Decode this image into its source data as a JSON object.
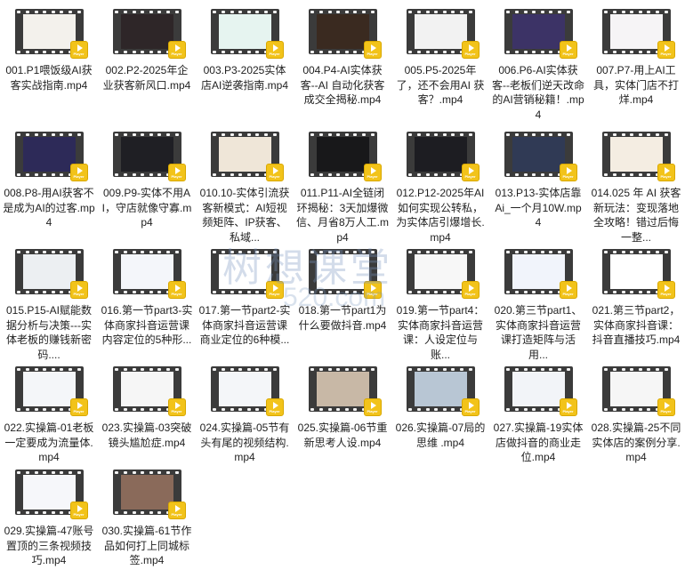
{
  "badge_text": "Player",
  "watermark": {
    "main": "树想课堂",
    "sub": "520.com"
  },
  "files": [
    {
      "name": "001.P1喂饭级AI获客实战指南.mp4",
      "bg": "#f3f1ec"
    },
    {
      "name": "002.P2-2025年企业获客新风口.mp4",
      "bg": "#2e2628"
    },
    {
      "name": "003.P3-2025实体店AI逆袭指南.mp4",
      "bg": "#e6f4f0"
    },
    {
      "name": "004.P4-AI实体获客--AI 自动化获客成交全揭秘.mp4",
      "bg": "#3a2a20"
    },
    {
      "name": "005.P5-2025年了，还不会用AI 获客？.mp4",
      "bg": "#f2f2f2"
    },
    {
      "name": "006.P6-AI实体获客--老板们逆天改命的AI营销秘籍！.mp4",
      "bg": "#3c3366"
    },
    {
      "name": "007.P7-用上AI工具，实体门店不打烊.mp4",
      "bg": "#f6f4f6"
    },
    {
      "name": "008.P8-用AI获客不是成为AI的过客.mp4",
      "bg": "#2d2a58"
    },
    {
      "name": "009.P9-实体不用AI，守店就像守寡.mp4",
      "bg": "#1f1f24"
    },
    {
      "name": "010.10-实体引流获客新模式：AI短视频矩阵、IP获客、私域...",
      "bg": "#efe6d8"
    },
    {
      "name": "011.P11-AI全链闭环揭秘：3天加爆微信、月省8万人工.mp4",
      "bg": "#18181a"
    },
    {
      "name": "012.P12-2025年AI如何实现公转私，为实体店引爆增长.mp4",
      "bg": "#1d1d22"
    },
    {
      "name": "013.P13-实体店靠Ai_一个月10W.mp4",
      "bg": "#303a55"
    },
    {
      "name": "014.025 年 AI 获客新玩法：变现落地全攻略！错过后悔一整...",
      "bg": "#f4ede2"
    },
    {
      "name": "015.P15-AI赋能数据分析与决策---实体老板的赚钱新密码....",
      "bg": "#eceff2"
    },
    {
      "name": "016.第一节part3-实体商家抖音运营课内容定位的5种形...",
      "bg": "#f4f6fa"
    },
    {
      "name": "017.第一节part2-实体商家抖音运营课商业定位的6种模...",
      "bg": "#ffffff"
    },
    {
      "name": "018.第一节part1为什么要做抖音.mp4",
      "bg": "#ffffff"
    },
    {
      "name": "019.第一节part4：实体商家抖音运营课：人设定位与账...",
      "bg": "#f7f7f7"
    },
    {
      "name": "020.第三节part1、实体商家抖音运营课打造矩阵与活用...",
      "bg": "#f1f4fb"
    },
    {
      "name": "021.第三节part2，实体商家抖音课：抖音直播技巧.mp4",
      "bg": "#ffffff"
    },
    {
      "name": "022.实操篇-01老板一定要成为流量体.mp4",
      "bg": "#f4f6f9"
    },
    {
      "name": "023.实操篇-03突破镜头尴尬症.mp4",
      "bg": "#f6f6f6"
    },
    {
      "name": "024.实操篇-05节有头有尾的视频结构.mp4",
      "bg": "#f4f6f9"
    },
    {
      "name": "025.实操篇-06节重新思考人设.mp4",
      "bg": "#c8b8a6"
    },
    {
      "name": "026.实操篇-07局的思维  .mp4",
      "bg": "#b8c6d4"
    },
    {
      "name": "027.实操篇-19实体店做抖音的商业走位.mp4",
      "bg": "#f2f4f8"
    },
    {
      "name": "028.实操篇-25不同实体店的案例分享.mp4",
      "bg": "#f6f6f6"
    },
    {
      "name": "029.实操篇-47账号置顶的三条视频技巧.mp4",
      "bg": "#f6f7fa"
    },
    {
      "name": "030.实操篇-61节作品如何打上同城标签.mp4",
      "bg": "#8a6a5a"
    }
  ]
}
